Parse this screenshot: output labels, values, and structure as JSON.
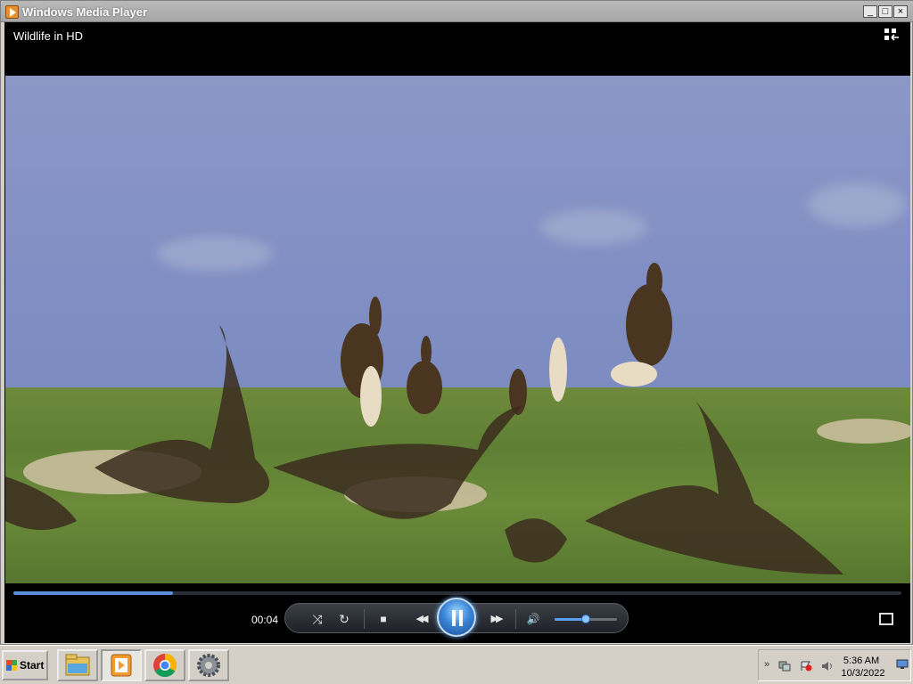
{
  "window": {
    "title": "Windows Media Player",
    "minimize_label": "_",
    "maximize_label": "□",
    "close_label": "×"
  },
  "player": {
    "media_title": "Wildlife in HD",
    "elapsed_time": "00:04",
    "seek_progress_fraction": 0.18,
    "volume_fraction": 0.5,
    "state": "playing"
  },
  "controls": {
    "shuffle_glyph": "⤨",
    "repeat_glyph": "↻",
    "stop_glyph": "■",
    "previous_glyph": "◀◀",
    "next_glyph": "▶▶",
    "mute_glyph": "🔊"
  },
  "taskbar": {
    "start_label": "Start",
    "pinned": [
      "file-explorer-icon",
      "windows-media-player-icon",
      "chrome-icon",
      "settings-gear-icon"
    ],
    "tray": {
      "expand_glyph": "»",
      "clock_time": "5:36 AM",
      "clock_date": "10/3/2022"
    }
  },
  "colors": {
    "accent": "#3a86d6",
    "seek_fill": "#5a8fd8",
    "titlebar": "#b0b0b0"
  }
}
